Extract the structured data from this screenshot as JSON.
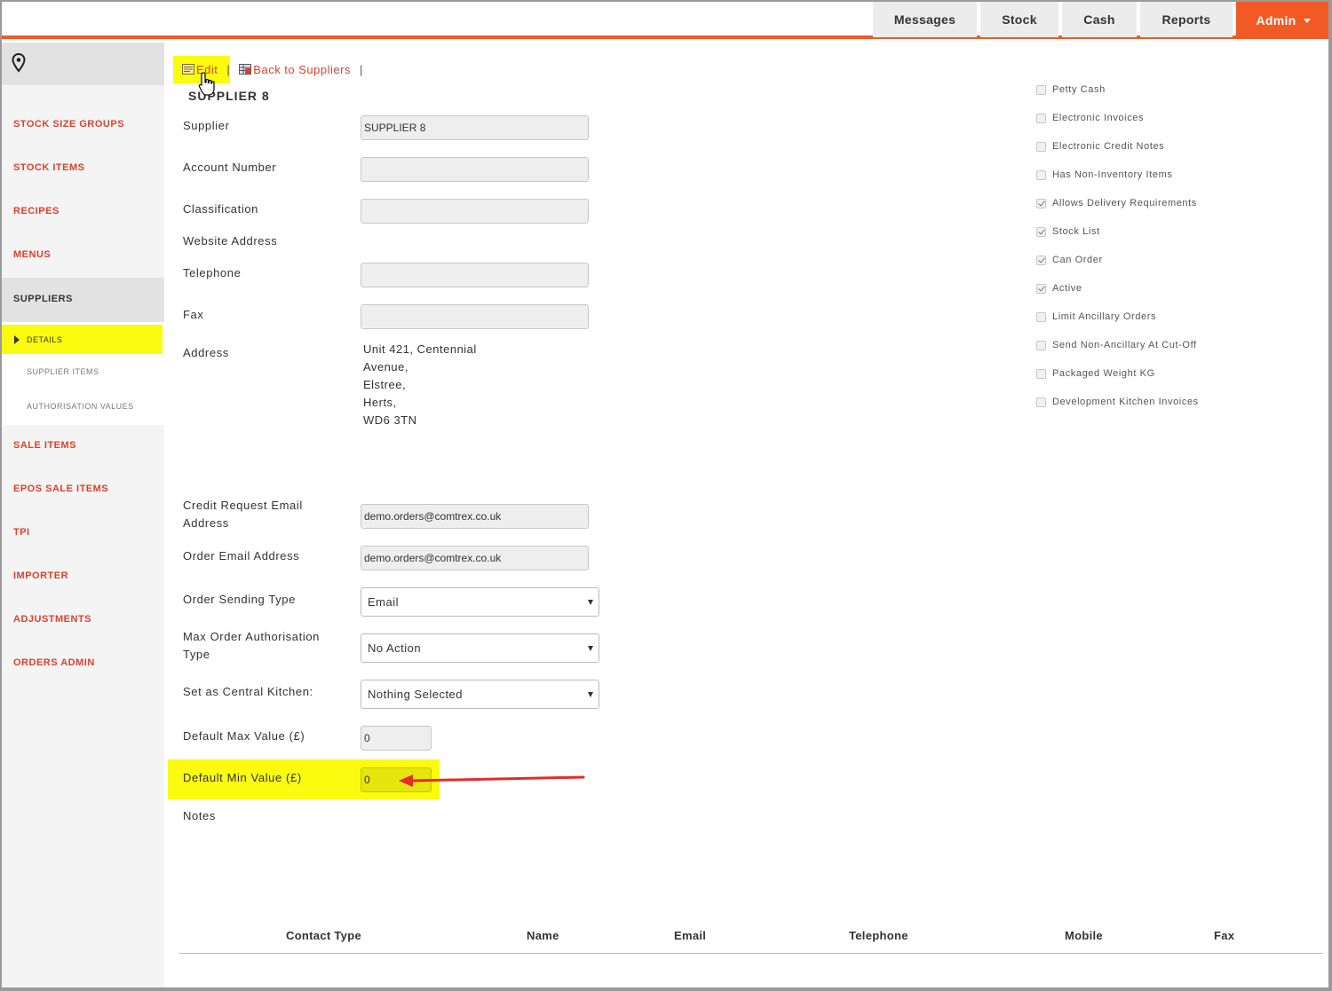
{
  "topnav": {
    "tabs": [
      "Messages",
      "Stock",
      "Cash",
      "Reports"
    ],
    "admin_label": "Admin"
  },
  "sidebar": {
    "items": [
      "STOCK SIZE GROUPS",
      "STOCK ITEMS",
      "RECIPES",
      "MENUS"
    ],
    "active_item": "SUPPLIERS",
    "sub_items": [
      "DETAILS",
      "SUPPLIER ITEMS",
      "AUTHORISATION VALUES"
    ],
    "items_after": [
      "SALE ITEMS",
      "EPOS SALE ITEMS",
      "TPI",
      "IMPORTER",
      "ADJUSTMENTS",
      "ORDERS ADMIN"
    ]
  },
  "toolbar": {
    "edit_label": "Edit",
    "back_label": "Back to Suppliers",
    "separator": "|"
  },
  "supplier_title": "SUPPLIER 8",
  "form": {
    "supplier_label": "Supplier",
    "supplier_value": "SUPPLIER 8",
    "account_label": "Account Number",
    "account_value": "",
    "classification_label": "Classification",
    "classification_value": "",
    "website_label": "Website Address",
    "telephone_label": "Telephone",
    "telephone_value": "",
    "fax_label": "Fax",
    "fax_value": "",
    "address_label": "Address",
    "address_lines": [
      "Unit 421, Centennial",
      "Avenue,",
      "Elstree,",
      "Herts,",
      "WD6 3TN"
    ],
    "credit_email_label_1": "Credit Request Email",
    "credit_email_label_2": "Address",
    "credit_email_value": "demo.orders@comtrex.co.uk",
    "order_email_label": "Order Email Address",
    "order_email_value": "demo.orders@comtrex.co.uk",
    "order_sending_label": "Order Sending Type",
    "order_sending_value": "Email",
    "max_auth_label_1": "Max Order Authorisation",
    "max_auth_label_2": "Type",
    "max_auth_value": "No Action",
    "central_kitchen_label": "Set as Central Kitchen:",
    "central_kitchen_value": "Nothing Selected",
    "default_max_label": "Default Max Value (£)",
    "default_max_value": "0",
    "default_min_label": "Default Min Value (£)",
    "default_min_value": "0",
    "notes_label": "Notes"
  },
  "options": [
    {
      "label": "Petty Cash",
      "checked": false
    },
    {
      "label": "Electronic Invoices",
      "checked": false
    },
    {
      "label": "Electronic Credit Notes",
      "checked": false
    },
    {
      "label": "Has Non-Inventory Items",
      "checked": false
    },
    {
      "label": "Allows Delivery Requirements",
      "checked": true
    },
    {
      "label": "Stock List",
      "checked": true
    },
    {
      "label": "Can Order",
      "checked": true
    },
    {
      "label": "Active",
      "checked": true
    },
    {
      "label": "Limit Ancillary Orders",
      "checked": false
    },
    {
      "label": "Send Non-Ancillary At Cut-Off",
      "checked": false
    },
    {
      "label": "Packaged Weight KG",
      "checked": false
    },
    {
      "label": "Development Kitchen Invoices",
      "checked": false
    }
  ],
  "contacts_table": {
    "headers": [
      "Contact Type",
      "Name",
      "Email",
      "Telephone",
      "Mobile",
      "Fax"
    ]
  },
  "colors": {
    "accent": "#f15a24",
    "link": "#e0402a",
    "highlight": "#fbfb0f",
    "annotation_arrow": "#e52b2b"
  },
  "icons": [
    "location-pin-icon",
    "edit-icon",
    "back-list-icon",
    "hand-cursor-icon",
    "annotation-arrow-icon"
  ]
}
